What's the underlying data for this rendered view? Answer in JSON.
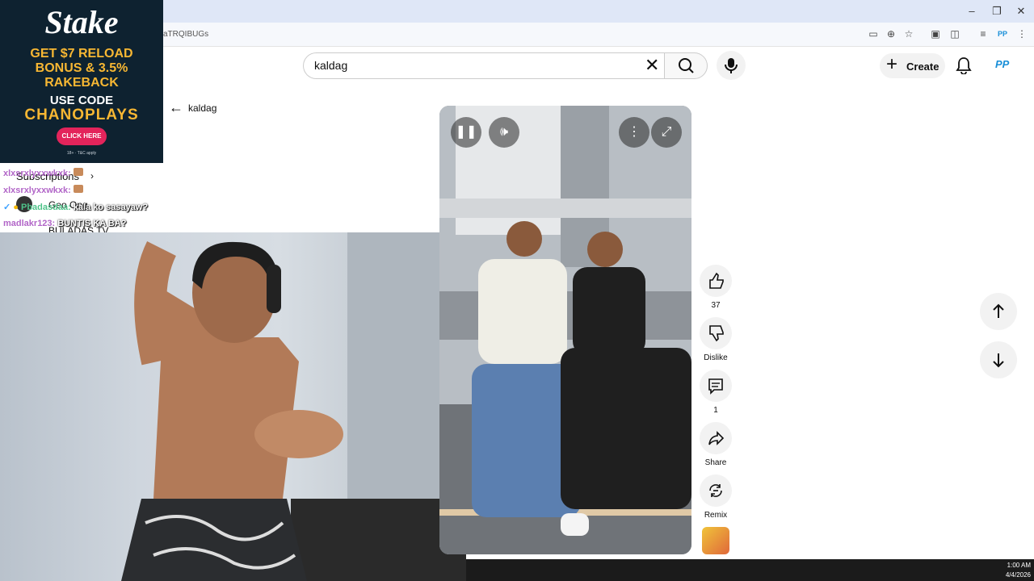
{
  "browser": {
    "url_tail": "aTRQIBUGs",
    "window_controls": [
      "minimize-icon",
      "restore-icon",
      "close-icon"
    ]
  },
  "header": {
    "search_value": "kaldag",
    "create_label": "Create",
    "avatar_initials": "PP"
  },
  "back": {
    "query_label": "kaldag"
  },
  "sidebar_fragments": [
    "Subscriptions",
    "Geo Ong",
    "BULADAS TV"
  ],
  "ad": {
    "logo": "Stake",
    "line1": "GET $7 RELOAD",
    "line2": "BONUS & 3.5%",
    "line3": "RAKEBACK",
    "use_code": "USE CODE",
    "code": "CHANOPLAYS",
    "cta": "CLICK HERE",
    "fine_print": "18+ · T&C apply"
  },
  "chat": [
    {
      "user": "xlxsrxlyxxwkxk:",
      "msg": ""
    },
    {
      "user": "xlxsrxlyxxwkxk:",
      "msg": ""
    },
    {
      "user": "Pbadasdaa:",
      "msg": "kala ko sasayaw?"
    },
    {
      "user": "madlakr123:",
      "msg": "BUNTIS KA BA?"
    }
  ],
  "actions": {
    "like_count": "37",
    "dislike_label": "Dislike",
    "comment_count": "1",
    "share_label": "Share",
    "remix_label": "Remix"
  },
  "taskbar": {
    "time": "1:00 AM",
    "date": "4/4/2026"
  },
  "colors": {
    "ad_bg": "#0e2230",
    "ad_accent": "#f7b733",
    "ad_button": "#e3245b",
    "chat_name": "#b266c8"
  }
}
